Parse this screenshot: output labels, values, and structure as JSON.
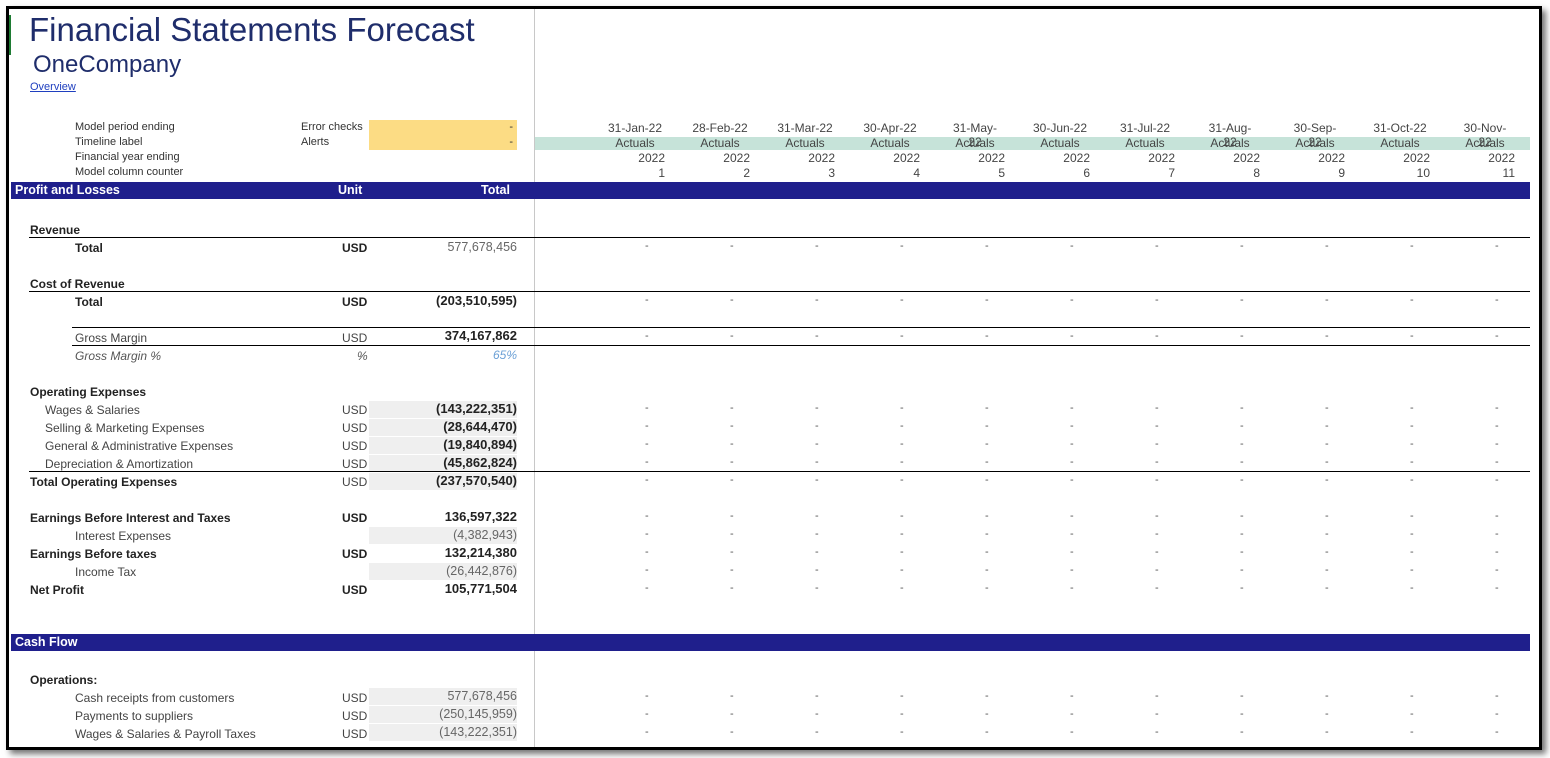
{
  "header": {
    "title": "Financial Statements Forecast",
    "company": "OneCompany",
    "overview_link": "Overview"
  },
  "timeline_labels": {
    "period": "Model period ending",
    "timeline": "Timeline label",
    "fy": "Financial year ending",
    "counter": "Model column counter",
    "error_checks": "Error checks",
    "alerts": "Alerts",
    "error_value": "-",
    "alerts_value": "-"
  },
  "columns": [
    {
      "date": "31-Jan-22",
      "label": "Actuals",
      "fy": "2022",
      "n": "1"
    },
    {
      "date": "28-Feb-22",
      "label": "Actuals",
      "fy": "2022",
      "n": "2"
    },
    {
      "date": "31-Mar-22",
      "label": "Actuals",
      "fy": "2022",
      "n": "3"
    },
    {
      "date": "30-Apr-22",
      "label": "Actuals",
      "fy": "2022",
      "n": "4"
    },
    {
      "date": "31-May-22",
      "label": "Actuals",
      "fy": "2022",
      "n": "5"
    },
    {
      "date": "30-Jun-22",
      "label": "Actuals",
      "fy": "2022",
      "n": "6"
    },
    {
      "date": "31-Jul-22",
      "label": "Actuals",
      "fy": "2022",
      "n": "7"
    },
    {
      "date": "31-Aug-22",
      "label": "Actuals",
      "fy": "2022",
      "n": "8"
    },
    {
      "date": "30-Sep-22",
      "label": "Actuals",
      "fy": "2022",
      "n": "9"
    },
    {
      "date": "31-Oct-22",
      "label": "Actuals",
      "fy": "2022",
      "n": "10"
    },
    {
      "date": "30-Nov-22",
      "label": "Actuals",
      "fy": "2022",
      "n": "11"
    }
  ],
  "dash": "-",
  "pl": {
    "section": "Profit and Losses",
    "unit_header": "Unit",
    "total_header": "Total",
    "revenue_title": "Revenue",
    "revenue_total_label": "Total",
    "revenue_total_unit": "USD",
    "revenue_total_value": "577,678,456",
    "cor_title": "Cost of Revenue",
    "cor_total_label": "Total",
    "cor_total_unit": "USD",
    "cor_total_value": "(203,510,595)",
    "gm_label": "Gross Margin",
    "gm_unit": "USD",
    "gm_value": "374,167,862",
    "gmp_label": "Gross Margin %",
    "gmp_unit": "%",
    "gmp_value": "65%",
    "opex_title": "Operating Expenses",
    "wages_label": "Wages & Salaries",
    "wages_unit": "USD",
    "wages_value": "(143,222,351)",
    "sm_label": "Selling & Marketing Expenses",
    "sm_unit": "USD",
    "sm_value": "(28,644,470)",
    "ga_label": "General & Administrative Expenses",
    "ga_unit": "USD",
    "ga_value": "(19,840,894)",
    "da_label": "Depreciation & Amortization",
    "da_unit": "USD",
    "da_value": "(45,862,824)",
    "topex_label": "Total Operating Expenses",
    "topex_unit": "USD",
    "topex_value": "(237,570,540)",
    "ebit_label": "Earnings Before Interest and Taxes",
    "ebit_unit": "USD",
    "ebit_value": "136,597,322",
    "int_label": "Interest Expenses",
    "int_value": "(4,382,943)",
    "ebt_label": "Earnings Before taxes",
    "ebt_unit": "USD",
    "ebt_value": "132,214,380",
    "tax_label": "Income Tax",
    "tax_value": "(26,442,876)",
    "np_label": "Net Profit",
    "np_unit": "USD",
    "np_value": "105,771,504"
  },
  "cf": {
    "section": "Cash Flow",
    "ops_title": "Operations:",
    "rec_label": "Cash receipts from customers",
    "rec_unit": "USD",
    "rec_value": "577,678,456",
    "pay_label": "Payments to suppliers",
    "pay_unit": "USD",
    "pay_value": "(250,145,959)",
    "wsp_label": "Wages & Salaries & Payroll Taxes",
    "wsp_unit": "USD",
    "wsp_value": "(143,222,351)"
  }
}
